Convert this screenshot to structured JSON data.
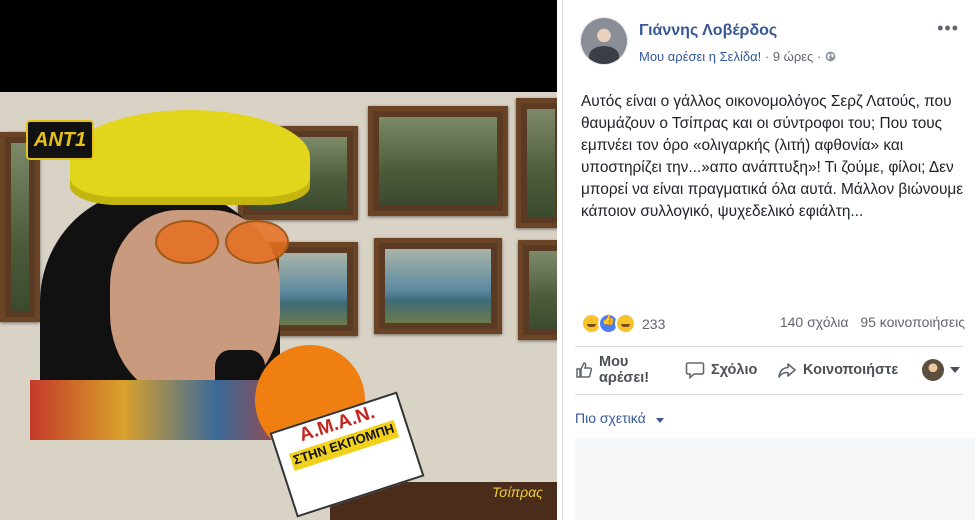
{
  "video": {
    "channel_logo": "ANT1",
    "mic_flag_top": "A.M.A.N.",
    "mic_flag_bottom": "ΣΤΗΝ ΕΚΠΟΜΠΗ",
    "watermark": "Τσίπρας"
  },
  "post": {
    "author": "Γιάννης Λοβέρδος",
    "like_page": "Μου αρέσει η Σελίδα!",
    "separator": "·",
    "time": "9 ώρες",
    "audience_icon": "globe-icon",
    "more_icon": "•••",
    "body": "Αυτός είναι ο γάλλος οικονομολόγος Σερζ Λατούς, που θαυμάζουν ο Τσίπρας και οι σύντροφοι του; Που τους εμπνέει τον όρο «ολιγαρκής (λιτή) αφθονία» και υποστηρίζει την...»απο ανάπτυξη»! Τι ζούμε, φίλοι; Δεν μπορεί να είναι πραγματικά όλα αυτά. Μάλλον βιώνουμε κάποιον συλλογικό, ψυχεδελικό εφιάλτη..."
  },
  "stats": {
    "reaction_icons": [
      "haha-icon",
      "like-icon",
      "sad-icon"
    ],
    "reaction_count": "233",
    "comments": "140 σχόλια",
    "shares": "95 κοινοποιήσεις"
  },
  "actions": {
    "like_line1": "Μου",
    "like_line2": "αρέσει!",
    "comment": "Σχόλιο",
    "share": "Κοινοποιήστε"
  },
  "comments_section": {
    "sort_label": "Πιο σχετικά"
  },
  "colors": {
    "link": "#365899",
    "text": "#1d2129",
    "muted": "#606770",
    "divider": "#dadde1"
  }
}
